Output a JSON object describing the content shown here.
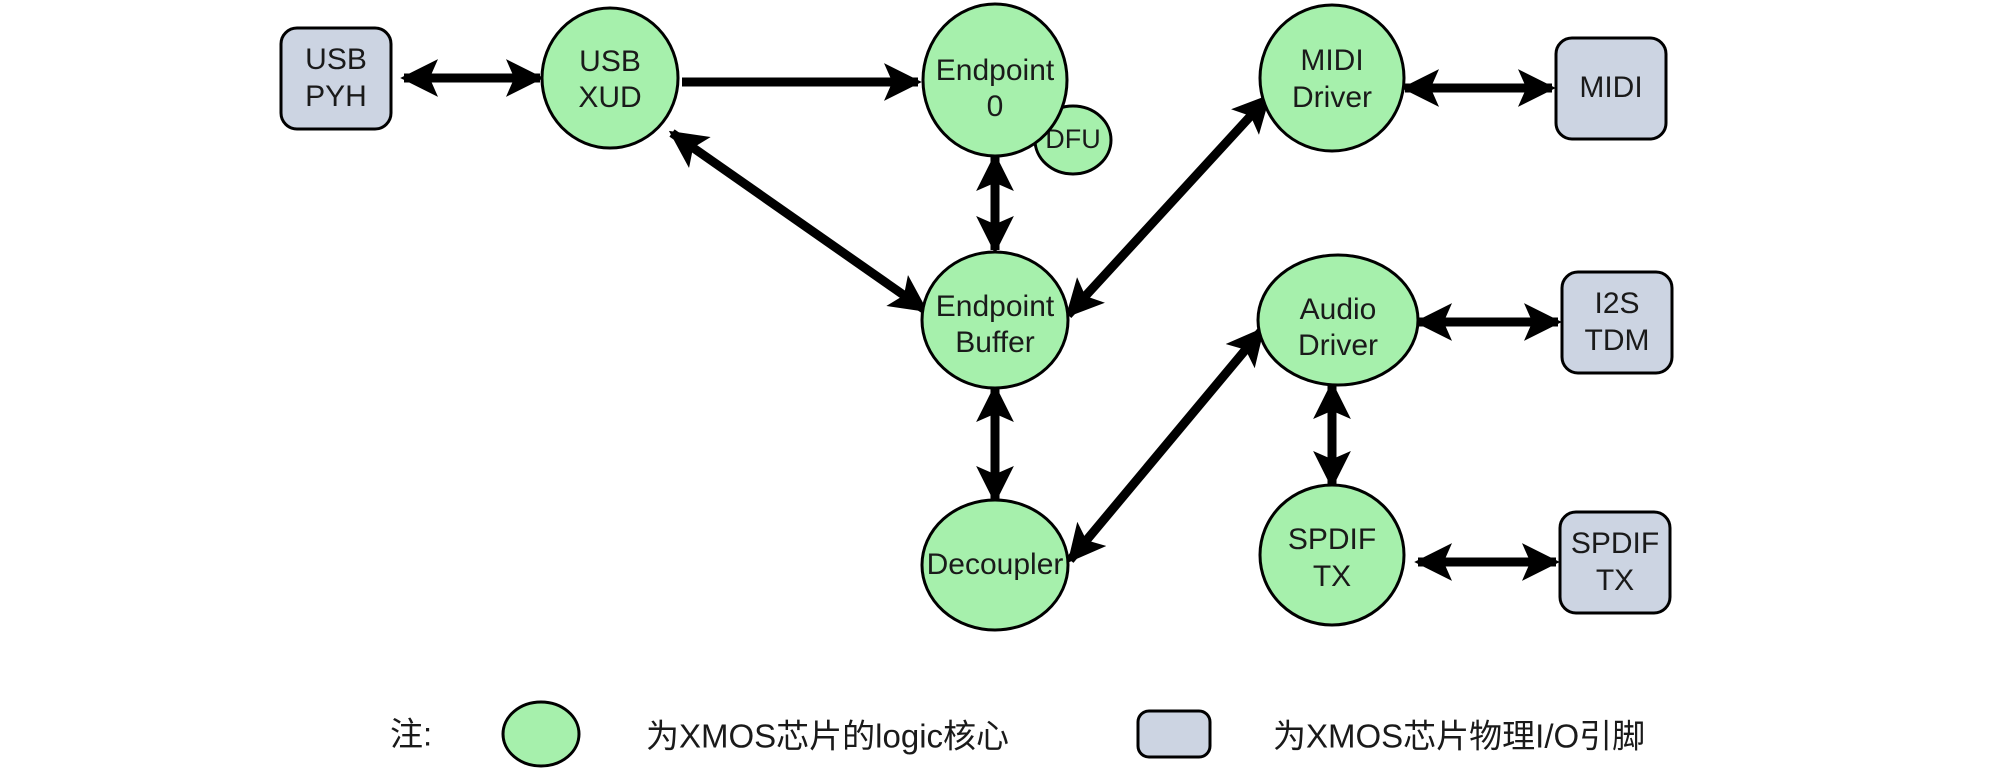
{
  "title": "XMOS USB Audio Architecture Block Diagram",
  "colors": {
    "logic_core_fill": "#a6f0ac",
    "io_pin_fill": "#ccd4e2",
    "stroke": "#000000",
    "arrow": "#000000",
    "background": "#ffffff"
  },
  "nodes": {
    "usb_phy": {
      "label_line1": "USB",
      "label_line2": "PYH",
      "kind": "io-pin",
      "shape": "rounded-rect"
    },
    "usb_xud": {
      "label_line1": "USB",
      "label_line2": "XUD",
      "kind": "logic-core",
      "shape": "ellipse"
    },
    "endpoint0": {
      "label_line1": "Endpoint",
      "label_line2": "0",
      "kind": "logic-core",
      "shape": "ellipse"
    },
    "dfu": {
      "label_line1": "DFU",
      "label_line2": "",
      "kind": "logic-core",
      "shape": "ellipse"
    },
    "midi_driver": {
      "label_line1": "MIDI",
      "label_line2": "Driver",
      "kind": "logic-core",
      "shape": "ellipse"
    },
    "midi_io": {
      "label_line1": "MIDI",
      "label_line2": "",
      "kind": "io-pin",
      "shape": "rounded-rect"
    },
    "endpoint_buffer": {
      "label_line1": "Endpoint",
      "label_line2": "Buffer",
      "kind": "logic-core",
      "shape": "ellipse"
    },
    "audio_driver": {
      "label_line1": "Audio",
      "label_line2": "Driver",
      "kind": "logic-core",
      "shape": "ellipse"
    },
    "i2s_tdm": {
      "label_line1": "I2S",
      "label_line2": "TDM",
      "kind": "io-pin",
      "shape": "rounded-rect"
    },
    "decoupler": {
      "label_line1": "Decoupler",
      "label_line2": "",
      "kind": "logic-core",
      "shape": "ellipse"
    },
    "spdif_tx_core": {
      "label_line1": "SPDIF",
      "label_line2": "TX",
      "kind": "logic-core",
      "shape": "ellipse"
    },
    "spdif_tx_io": {
      "label_line1": "SPDIF",
      "label_line2": "TX",
      "kind": "io-pin",
      "shape": "rounded-rect"
    }
  },
  "edges": [
    {
      "from": "usb_phy",
      "to": "usb_xud",
      "direction": "both"
    },
    {
      "from": "usb_xud",
      "to": "endpoint0",
      "direction": "forward"
    },
    {
      "from": "usb_xud",
      "to": "endpoint_buffer",
      "direction": "both"
    },
    {
      "from": "endpoint_buffer",
      "to": "endpoint0",
      "direction": "both"
    },
    {
      "from": "endpoint_buffer",
      "to": "midi_driver",
      "direction": "both"
    },
    {
      "from": "midi_driver",
      "to": "midi_io",
      "direction": "both"
    },
    {
      "from": "endpoint_buffer",
      "to": "decoupler",
      "direction": "both"
    },
    {
      "from": "decoupler",
      "to": "audio_driver",
      "direction": "both"
    },
    {
      "from": "audio_driver",
      "to": "i2s_tdm",
      "direction": "both"
    },
    {
      "from": "audio_driver",
      "to": "spdif_tx_core",
      "direction": "both"
    },
    {
      "from": "spdif_tx_core",
      "to": "spdif_tx_io",
      "direction": "both"
    }
  ],
  "legend": {
    "note_label": "注:",
    "items": [
      {
        "swatch": "green-circle",
        "text": "为XMOS芯片的logic核心"
      },
      {
        "swatch": "gray-rounded-rect",
        "text": "为XMOS芯片物理I/O引脚"
      }
    ]
  }
}
